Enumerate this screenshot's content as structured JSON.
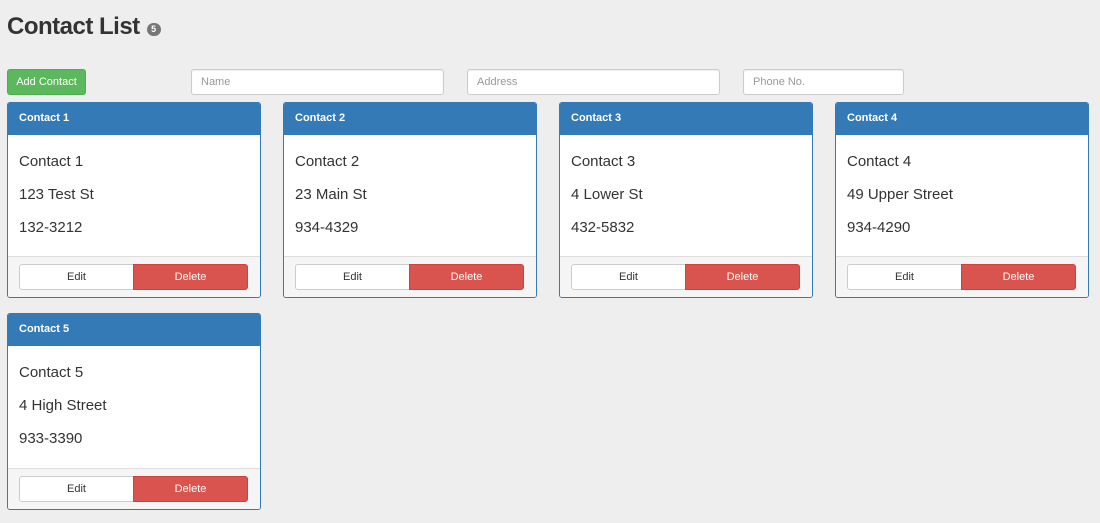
{
  "header": {
    "title": "Contact List",
    "count": "5"
  },
  "toolbar": {
    "add_label": "Add Contact"
  },
  "filters": {
    "name_placeholder": "Name",
    "address_placeholder": "Address",
    "phone_placeholder": "Phone No."
  },
  "card_actions": {
    "edit_label": "Edit",
    "delete_label": "Delete"
  },
  "contacts": [
    {
      "header": "Contact 1",
      "name": "Contact 1",
      "address": "123 Test St",
      "phone": "132-3212"
    },
    {
      "header": "Contact 2",
      "name": "Contact 2",
      "address": "23 Main St",
      "phone": "934-4329"
    },
    {
      "header": "Contact 3",
      "name": "Contact 3",
      "address": "4 Lower St",
      "phone": "432-5832"
    },
    {
      "header": "Contact 4",
      "name": "Contact 4",
      "address": "49 Upper Street",
      "phone": "934-4290"
    },
    {
      "header": "Contact 5",
      "name": "Contact 5",
      "address": "4 High Street",
      "phone": "933-3390"
    }
  ],
  "colors": {
    "primary": "#337ab7",
    "success": "#5cb85c",
    "danger": "#d9534f",
    "background": "#eeeeee"
  }
}
